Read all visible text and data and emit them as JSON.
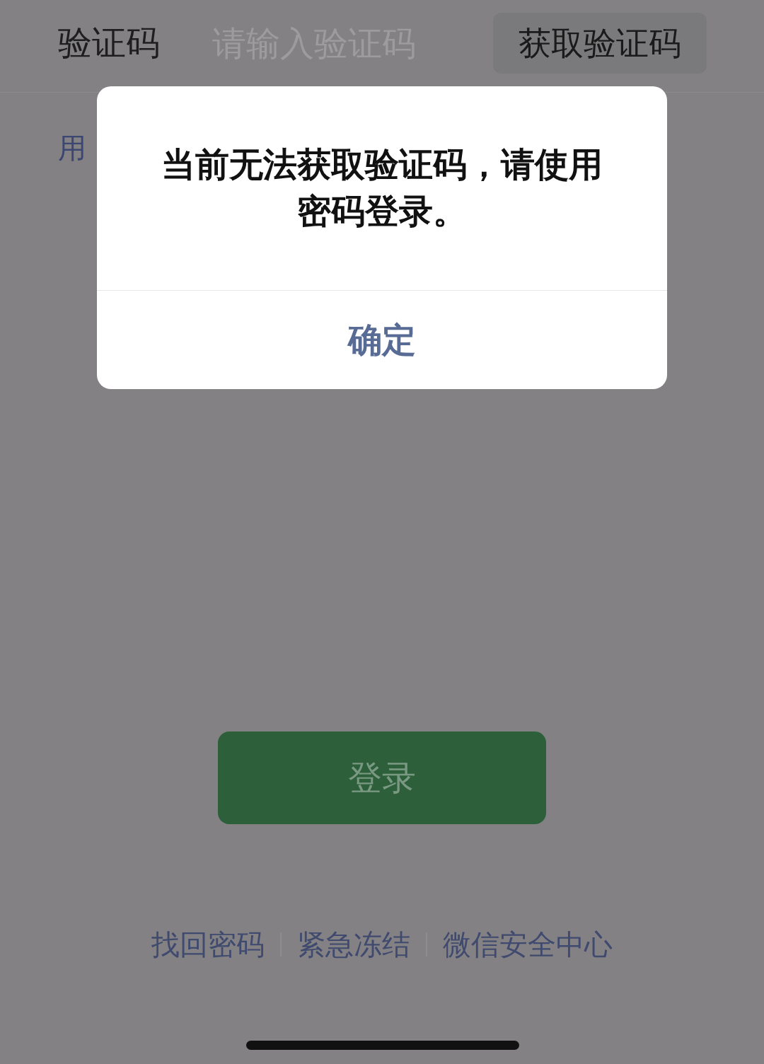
{
  "code_row": {
    "label": "验证码",
    "placeholder": "请输入验证码",
    "get_code_button": "获取验证码"
  },
  "password_login_link": "用",
  "login_button": {
    "label": "登录",
    "disabled": true
  },
  "footer_links": [
    "找回密码",
    "紧急冻结",
    "微信安全中心"
  ],
  "dialog": {
    "message": "当前无法获取验证码，请使用密码登录。",
    "button": "确定"
  }
}
